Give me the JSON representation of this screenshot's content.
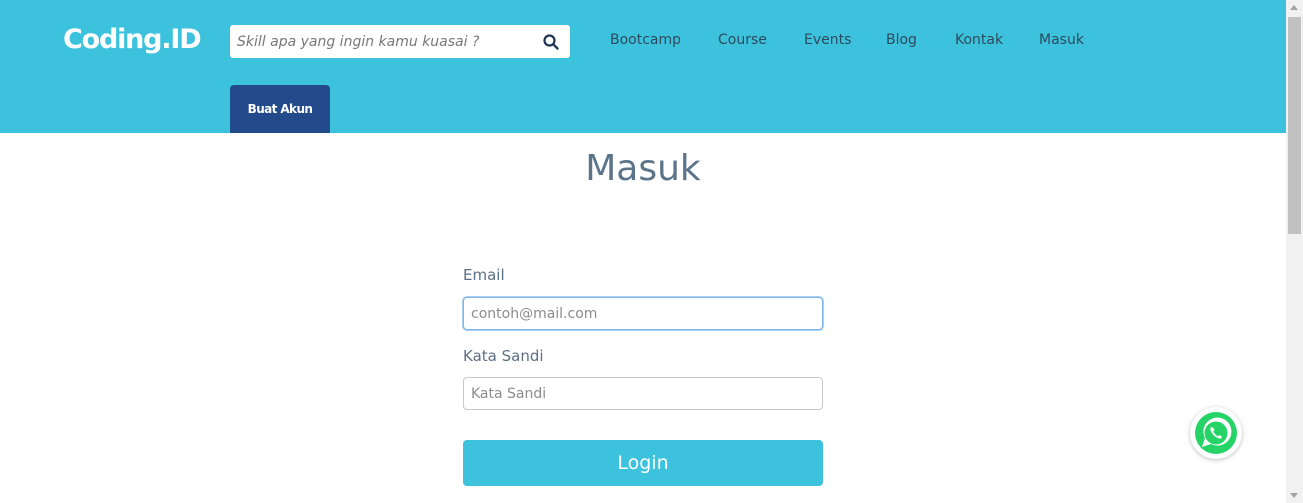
{
  "header": {
    "logo": "Coding.ID",
    "search_placeholder": "Skill apa yang ingin kamu kuasai ?",
    "search_icon": "search-icon",
    "nav": [
      {
        "label": "Bootcamp"
      },
      {
        "label": "Course"
      },
      {
        "label": "Events"
      },
      {
        "label": "Blog"
      },
      {
        "label": "Kontak"
      },
      {
        "label": "Masuk"
      }
    ],
    "signup_label": "Buat Akun"
  },
  "main": {
    "title": "Masuk",
    "email_label": "Email",
    "email_placeholder": "contoh@mail.com",
    "email_value": "",
    "password_label": "Kata Sandi",
    "password_placeholder": "Kata Sandi",
    "password_value": "",
    "login_label": "Login"
  },
  "floating": {
    "icon": "whatsapp-icon"
  },
  "colors": {
    "brand": "#3dc2dd",
    "signup": "#234a8a",
    "whatsapp": "#25d366"
  }
}
